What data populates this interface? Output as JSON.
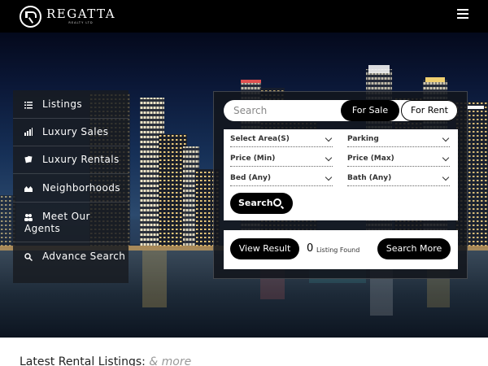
{
  "brand": {
    "name": "REGATTA",
    "tagline": "REALTY LTD"
  },
  "header": {
    "menu_icon": "hamburger-icon"
  },
  "sidebar": {
    "items": [
      {
        "label": "Listings",
        "icon": "list-icon"
      },
      {
        "label": "Luxury Sales",
        "icon": "bar-chart-icon"
      },
      {
        "label": "Luxury Rentals",
        "icon": "documents-icon"
      },
      {
        "label": "Neighborhoods",
        "icon": "houses-icon"
      },
      {
        "label": "Meet Our Agents",
        "icon": "users-icon"
      },
      {
        "label": "Advance Search",
        "icon": "search-icon"
      }
    ]
  },
  "search": {
    "placeholder": "Search",
    "for_sale_label": "For Sale",
    "for_rent_label": "For Rent",
    "filters": {
      "area": "Select Area(S)",
      "parking": "Parking",
      "price_min": "Price (Min)",
      "price_max": "Price (Max)",
      "bed": "Bed (Any)",
      "bath": "Bath (Any)"
    },
    "search_button": "Search"
  },
  "results": {
    "view_label": "View Result",
    "count": "0",
    "count_label": "Listing Found",
    "more_label": "Search More"
  },
  "latest": {
    "title": "Latest Rental Listings:",
    "more": "& more"
  },
  "colors": {
    "header_bg": "#000000",
    "panel_bg": "#12161c",
    "button_bg": "#000000"
  }
}
